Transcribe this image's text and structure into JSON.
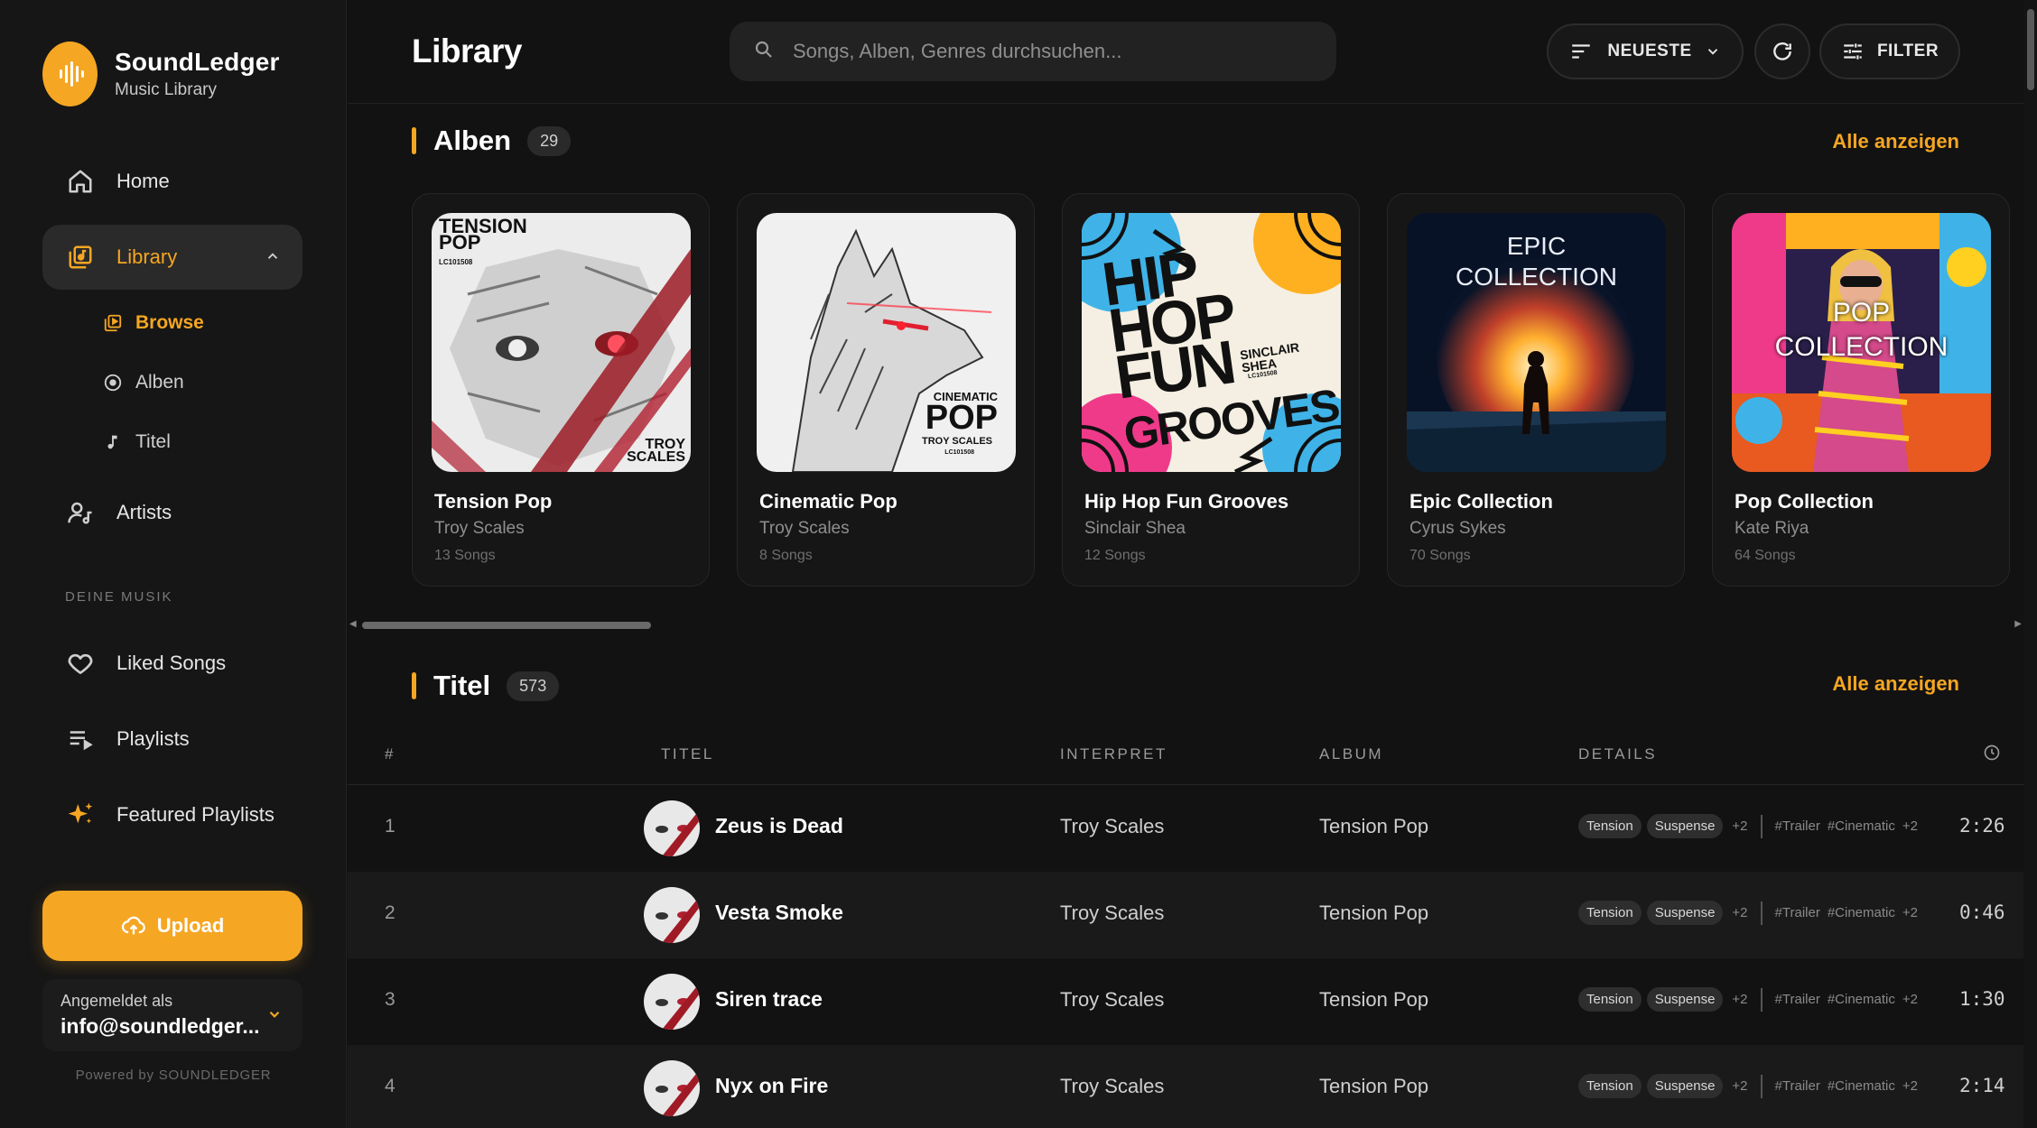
{
  "brand": {
    "name": "SoundLedger",
    "subtitle": "Music Library"
  },
  "nav": {
    "home": "Home",
    "library": "Library",
    "sub": {
      "browse": "Browse",
      "albums": "Alben",
      "titles": "Titel"
    },
    "artists": "Artists",
    "section_label": "DEINE MUSIK",
    "liked": "Liked Songs",
    "playlists": "Playlists",
    "featured": "Featured Playlists"
  },
  "upload_label": "Upload",
  "account": {
    "label": "Angemeldet als",
    "email": "info@soundledger..."
  },
  "powered": "Powered by SOUNDLEDGER",
  "header": {
    "title": "Library",
    "search_placeholder": "Songs, Alben, Genres durchsuchen...",
    "sort_label": "NEUESTE",
    "filter_label": "FILTER"
  },
  "albums_section": {
    "title": "Alben",
    "count": "29",
    "see_all": "Alle anzeigen"
  },
  "albums": [
    {
      "title": "Tension Pop",
      "artist": "Troy Scales",
      "songs": "13 Songs",
      "art_text": [
        "TENSION",
        "POP",
        "LC101508",
        "TROY",
        "SCALES"
      ]
    },
    {
      "title": "Cinematic Pop",
      "artist": "Troy Scales",
      "songs": "8 Songs",
      "art_text": [
        "CINEMATIC",
        "POP",
        "TROY SCALES",
        "LC101508"
      ]
    },
    {
      "title": "Hip Hop Fun Grooves",
      "artist": "Sinclair Shea",
      "songs": "12 Songs",
      "art_text": [
        "HIP",
        "HOP",
        "FUN",
        "GROOVES",
        "SINCLAIR",
        "SHEA",
        "LC101508"
      ]
    },
    {
      "title": "Epic Collection",
      "artist": "Cyrus Sykes",
      "songs": "70 Songs",
      "art_text": [
        "EPIC",
        "COLLECTION"
      ]
    },
    {
      "title": "Pop Collection",
      "artist": "Kate Riya",
      "songs": "64 Songs",
      "art_text": [
        "POP",
        "COLLECTION"
      ]
    }
  ],
  "tracks_section": {
    "title": "Titel",
    "count": "573",
    "see_all": "Alle anzeigen"
  },
  "table_headers": {
    "num": "#",
    "title": "TITEL",
    "artist": "INTERPRET",
    "album": "ALBUM",
    "details": "DETAILS"
  },
  "tracks": [
    {
      "num": "1",
      "title": "Zeus is Dead",
      "artist": "Troy Scales",
      "album": "Tension Pop",
      "tag1": "Tension",
      "tag2": "Suspense",
      "more": "+2",
      "hash1": "#Trailer",
      "hash2": "#Cinematic",
      "hash_more": "+2",
      "duration": "2:26"
    },
    {
      "num": "2",
      "title": "Vesta Smoke",
      "artist": "Troy Scales",
      "album": "Tension Pop",
      "tag1": "Tension",
      "tag2": "Suspense",
      "more": "+2",
      "hash1": "#Trailer",
      "hash2": "#Cinematic",
      "hash_more": "+2",
      "duration": "0:46"
    },
    {
      "num": "3",
      "title": "Siren trace",
      "artist": "Troy Scales",
      "album": "Tension Pop",
      "tag1": "Tension",
      "tag2": "Suspense",
      "more": "+2",
      "hash1": "#Trailer",
      "hash2": "#Cinematic",
      "hash_more": "+2",
      "duration": "1:30"
    },
    {
      "num": "4",
      "title": "Nyx on Fire",
      "artist": "Troy Scales",
      "album": "Tension Pop",
      "tag1": "Tension",
      "tag2": "Suspense",
      "more": "+2",
      "hash1": "#Trailer",
      "hash2": "#Cinematic",
      "hash_more": "+2",
      "duration": "2:14"
    }
  ],
  "colors": {
    "accent": "#f5a623",
    "background": "#121212",
    "sidebar": "#161616"
  }
}
